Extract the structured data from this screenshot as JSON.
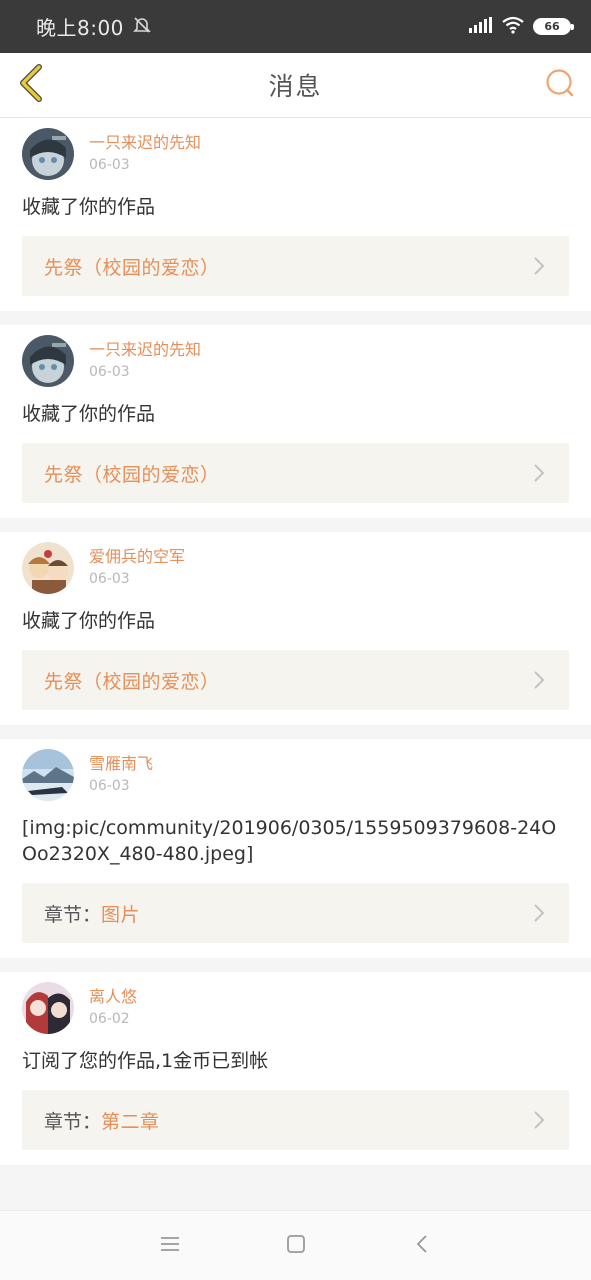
{
  "status_bar": {
    "time": "晚上8:00",
    "battery": "66"
  },
  "header": {
    "title": "消息"
  },
  "messages": [
    {
      "user": "一只来迟的先知",
      "date": "06-03",
      "body": "收藏了你的作品",
      "link_prefix": "",
      "link_text": "先祭（校园的爱恋）"
    },
    {
      "user": "一只来迟的先知",
      "date": "06-03",
      "body": "收藏了你的作品",
      "link_prefix": "",
      "link_text": "先祭（校园的爱恋）"
    },
    {
      "user": "爱佣兵的空军",
      "date": "06-03",
      "body": "收藏了你的作品",
      "link_prefix": "",
      "link_text": "先祭（校园的爱恋）"
    },
    {
      "user": "雪雁南飞",
      "date": "06-03",
      "body": "[img:pic/community/201906/0305/1559509379608-24OOo2320X_480-480.jpeg]",
      "link_prefix": "章节：",
      "link_text": "图片"
    },
    {
      "user": "离人悠",
      "date": "06-02",
      "body": "订阅了您的作品,1金币已到帐",
      "link_prefix": "章节：",
      "link_text": "第二章"
    }
  ],
  "colors": {
    "accent": "#e58f5a",
    "status_bar": "#3a3a3a",
    "link_bg": "#f5f4ee"
  },
  "icons": {
    "back": "back-arrow-icon",
    "search": "search-icon",
    "chevron": "chevron-right-icon"
  }
}
